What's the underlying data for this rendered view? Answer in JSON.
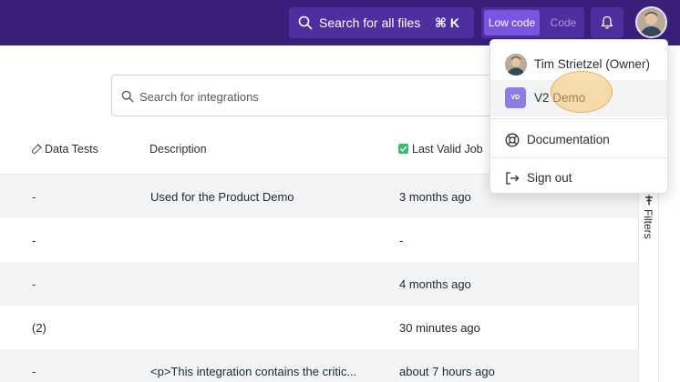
{
  "topbar": {
    "search_label": "Search for all files",
    "search_shortcut": "⌘ K",
    "mode_low_code": "Low code",
    "mode_code": "Code",
    "accent": "#3a1f7a"
  },
  "integrations": {
    "search_placeholder": "Search for integrations"
  },
  "table": {
    "headers": {
      "data_tests": "Data Tests",
      "description": "Description",
      "last_valid_job": "Last Valid Job"
    },
    "rows": [
      {
        "data_tests": "-",
        "description": "Used for the Product Demo",
        "last_valid_job": "3 months ago"
      },
      {
        "data_tests": "-",
        "description": "",
        "last_valid_job": "-"
      },
      {
        "data_tests": "-",
        "description": "",
        "last_valid_job": "4 months ago"
      },
      {
        "data_tests": "(2)",
        "description": "",
        "last_valid_job": "30 minutes ago"
      },
      {
        "data_tests": "-",
        "description": "<p>This integration contains the critic...",
        "last_valid_job": "about 7 hours ago"
      }
    ]
  },
  "filters_label": "Filters",
  "user_menu": {
    "owner": "Tim Strietzel (Owner)",
    "workspace_badge": "VD",
    "workspace": "V2 Demo",
    "documentation": "Documentation",
    "sign_out": "Sign out"
  }
}
